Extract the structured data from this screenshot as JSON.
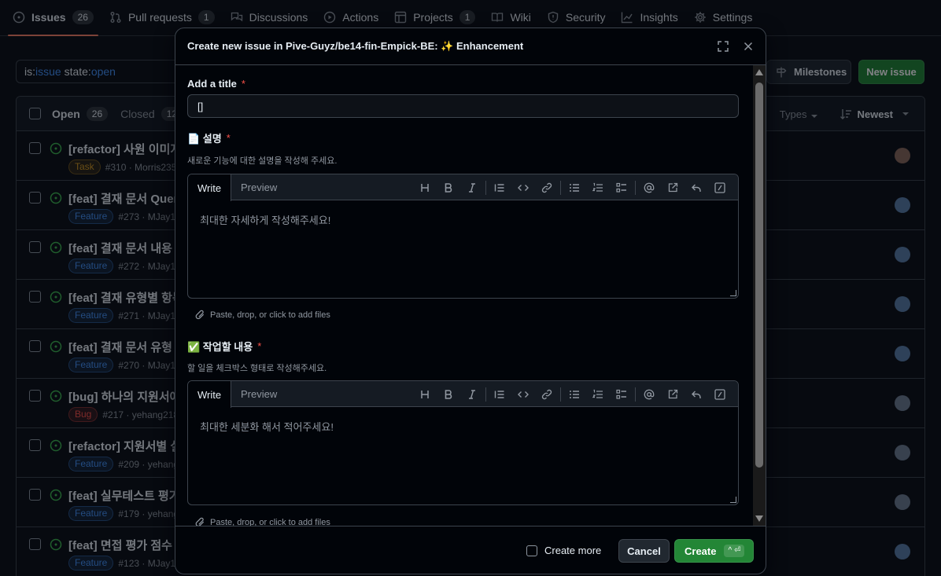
{
  "colors": {
    "bg": "#0d1117",
    "accent_green": "#238636",
    "open_icon": "#3fb950",
    "link_blue": "#4493f8",
    "required_red": "#f85149",
    "label_task": "#d29922",
    "label_feature": "#4493f8",
    "label_bug": "#f85149"
  },
  "nav": {
    "tabs": [
      {
        "label": "Issues",
        "count": "26",
        "icon": "issue-opened-icon"
      },
      {
        "label": "Pull requests",
        "count": "1",
        "icon": "git-pull-request-icon"
      },
      {
        "label": "Discussions",
        "icon": "comment-discussion-icon"
      },
      {
        "label": "Actions",
        "icon": "play-icon"
      },
      {
        "label": "Projects",
        "count": "1",
        "icon": "table-icon"
      },
      {
        "label": "Wiki",
        "icon": "book-icon"
      },
      {
        "label": "Security",
        "icon": "shield-icon"
      },
      {
        "label": "Insights",
        "icon": "graph-icon"
      },
      {
        "label": "Settings",
        "icon": "gear-icon"
      }
    ]
  },
  "filter": {
    "prefix1": "is:",
    "value1": "issue",
    "prefix2": " state:",
    "value2": "open"
  },
  "buttons": {
    "milestones": "Milestones",
    "new_issue": "New issue"
  },
  "list": {
    "open_label": "Open",
    "open_count": "26",
    "closed_label": "Closed",
    "closed_count": "128",
    "types_label": "Types",
    "sort_label": "Newest",
    "rows": [
      {
        "title": "[refactor] 사원 이미지",
        "label": "Task",
        "meta": "#310 · Morris235 o"
      },
      {
        "title": "[feat] 결재 문서 Quer",
        "label": "Feature",
        "meta": "#273 · MJay112"
      },
      {
        "title": "[feat] 결재 문서 내용",
        "label": "Feature",
        "meta": "#272 · MJay112"
      },
      {
        "title": "[feat] 결재 유형별 항목",
        "label": "Feature",
        "meta": "#271 · MJay112"
      },
      {
        "title": "[feat] 결재 문서 유형",
        "label": "Feature",
        "meta": "#270 · MJay112"
      },
      {
        "title": "[bug] 하나의 지원서에",
        "label": "Bug",
        "meta": "#217 · yehang218 o"
      },
      {
        "title": "[refactor] 지원서별 실",
        "label": "Feature",
        "meta": "#209 · yehang2"
      },
      {
        "title": "[feat] 실무테스트 평가",
        "label": "Feature",
        "meta": "#179 · yehang2"
      },
      {
        "title": "[feat] 면접 평가 점수",
        "label": "Feature",
        "meta": "#123 · MJay112"
      }
    ]
  },
  "dialog": {
    "title": "Create new issue in Pive-Guyz/be14-fin-Empick-BE: ✨ Enhancement",
    "title_field": {
      "label": "Add a title",
      "required": "*",
      "value": "[]"
    },
    "desc_field": {
      "label": "📄 설명",
      "required": "*",
      "hint": "새로운 기능에 대한 설명을 작성해 주세요.",
      "placeholder": "최대한 자세하게 작성해주세요!"
    },
    "tasks_field": {
      "label": "✅ 작업할 내용",
      "required": "*",
      "hint": "할 일을 체크박스 형태로 작성해주세요.",
      "placeholder": "최대한 세분화 해서 적어주세요!"
    },
    "editor_tabs": {
      "write": "Write",
      "preview": "Preview"
    },
    "attach_text": "Paste, drop, or click to add files",
    "create_more": "Create more",
    "cancel": "Cancel",
    "create": "Create",
    "create_shortcut": "^ ⏎"
  }
}
